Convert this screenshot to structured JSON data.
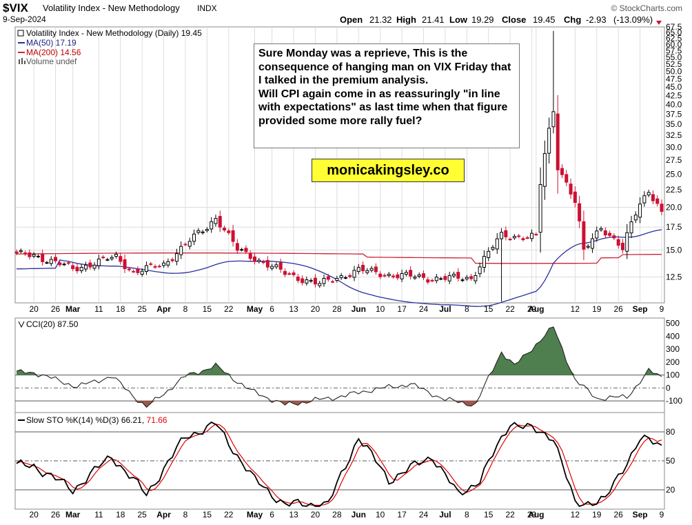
{
  "chart_data": [
    {
      "type": "candlestick",
      "symbol": "$VIX",
      "title": "Volatility Index - New Methodology",
      "exchange": "INDX",
      "date": "9-Sep-2024",
      "ohlc": {
        "open_label": "Open",
        "open": "21.32",
        "high_label": "High",
        "high": "21.41",
        "low_label": "Low",
        "low": "19.29",
        "close_label": "Close",
        "close": "19.45",
        "chg_label": "Chg",
        "chg": "-2.93",
        "chg_pct": "(-13.09%)"
      },
      "source": "© StockCharts.com",
      "legend": [
        {
          "name": "Volatility Index - New Methodology (Daily) 19.45",
          "color": "#000000"
        },
        {
          "name": "MA(50) 17.19",
          "color": "#1a237e"
        },
        {
          "name": "MA(200) 14.56",
          "color": "#c00000"
        },
        {
          "name": "Volume undef",
          "color": "#555555"
        }
      ],
      "yscale": "log",
      "ylim": [
        10.5,
        67.5
      ],
      "yticks": [
        "12.5",
        "15.0",
        "17.5",
        "20.0",
        "22.5",
        "25.0",
        "27.5",
        "30.0",
        "32.5",
        "35.0",
        "37.5",
        "40.0",
        "42.5",
        "45.0",
        "47.5",
        "50.0",
        "52.5",
        "55.0",
        "57.5",
        "60.0",
        "62.5",
        "65.0",
        "67.5"
      ],
      "xticks": [
        "20",
        "26",
        "Mar",
        "11",
        "18",
        "25",
        "Apr",
        "8",
        "15",
        "22",
        "May",
        "6",
        "13",
        "20",
        "28",
        "Jun",
        "10",
        "17",
        "24",
        "Jul",
        "8",
        "15",
        "22",
        "29",
        "Aug",
        "12",
        "19",
        "26",
        "Sep",
        "9"
      ],
      "ma50_last": 17.19,
      "ma200_last": 14.56,
      "last_close": 19.45,
      "anchors": [
        {
          "date": "Feb 20",
          "value": 14.5
        },
        {
          "date": "Mar 1",
          "value": 13.2
        },
        {
          "date": "Mar 15",
          "value": 14.3
        },
        {
          "date": "Mar 21",
          "value": 12.9
        },
        {
          "date": "Apr 1",
          "value": 13.6
        },
        {
          "date": "Apr 15",
          "value": 17.5
        },
        {
          "date": "Apr 19",
          "value": 18.7
        },
        {
          "date": "Apr 26",
          "value": 15.0
        },
        {
          "date": "May 10",
          "value": 12.8
        },
        {
          "date": "May 22",
          "value": 11.9
        },
        {
          "date": "Jun 3",
          "value": 13.1
        },
        {
          "date": "Jun 14",
          "value": 12.7
        },
        {
          "date": "Jun 28",
          "value": 12.4
        },
        {
          "date": "Jul 10",
          "value": 12.4
        },
        {
          "date": "Jul 19",
          "value": 16.5
        },
        {
          "date": "Jul 31",
          "value": 16.4
        },
        {
          "date": "Aug 2",
          "value": 23.4
        },
        {
          "date": "Aug 5",
          "value": 38.6
        },
        {
          "date": "Aug 7",
          "value": 27.9
        },
        {
          "date": "Aug 12",
          "value": 20.7
        },
        {
          "date": "Aug 16",
          "value": 14.8
        },
        {
          "date": "Aug 22",
          "value": 17.6
        },
        {
          "date": "Aug 29",
          "value": 15.0
        },
        {
          "date": "Sep 3",
          "value": 20.7
        },
        {
          "date": "Sep 6",
          "value": 22.4
        },
        {
          "date": "Sep 9",
          "value": 19.45
        }
      ]
    },
    {
      "type": "line",
      "title": "CCI(20) 87.50",
      "yticks": [
        "-100",
        "0",
        "100",
        "200",
        "300",
        "400",
        "500"
      ],
      "ylim": [
        -190,
        540
      ],
      "last": 87.5,
      "anchors": [
        {
          "date": "Feb 20",
          "value": 120
        },
        {
          "date": "Mar 4",
          "value": 10
        },
        {
          "date": "Mar 14",
          "value": 90
        },
        {
          "date": "Mar 26",
          "value": -150
        },
        {
          "date": "Apr 8",
          "value": 90
        },
        {
          "date": "Apr 19",
          "value": 170
        },
        {
          "date": "Apr 30",
          "value": -20
        },
        {
          "date": "May 10",
          "value": -130
        },
        {
          "date": "May 30",
          "value": -60
        },
        {
          "date": "Jun 7",
          "value": -20
        },
        {
          "date": "Jun 21",
          "value": 30
        },
        {
          "date": "Jul 1",
          "value": -90
        },
        {
          "date": "Jul 11",
          "value": -130
        },
        {
          "date": "Jul 19",
          "value": 280
        },
        {
          "date": "Jul 24",
          "value": 170
        },
        {
          "date": "Aug 5",
          "value": 470
        },
        {
          "date": "Aug 12",
          "value": 60
        },
        {
          "date": "Aug 20",
          "value": -80
        },
        {
          "date": "Aug 30",
          "value": -70
        },
        {
          "date": "Sep 6",
          "value": 130
        },
        {
          "date": "Sep 9",
          "value": 87.5
        }
      ]
    },
    {
      "type": "line",
      "title": "Slow STO %K(14) %D(3) 66.21, 71.66",
      "series": [
        {
          "name": "%K(14)",
          "color": "#000000",
          "last": 66.21
        },
        {
          "name": "%D(3)",
          "color": "#e00000",
          "last": 71.66
        }
      ],
      "yticks": [
        "20",
        "50",
        "80"
      ],
      "ylim": [
        0,
        100
      ],
      "anchors": [
        {
          "date": "Feb 20",
          "value": 45
        },
        {
          "date": "Mar 1",
          "value": 20
        },
        {
          "date": "Mar 14",
          "value": 55
        },
        {
          "date": "Mar 26",
          "value": 15
        },
        {
          "date": "Apr 10",
          "value": 75
        },
        {
          "date": "Apr 19",
          "value": 88
        },
        {
          "date": "May 1",
          "value": 30
        },
        {
          "date": "May 10",
          "value": 5
        },
        {
          "date": "May 24",
          "value": 5
        },
        {
          "date": "Jun 5",
          "value": 75
        },
        {
          "date": "Jun 14",
          "value": 30
        },
        {
          "date": "Jun 28",
          "value": 55
        },
        {
          "date": "Jul 5",
          "value": 15
        },
        {
          "date": "Jul 12",
          "value": 30
        },
        {
          "date": "Jul 23",
          "value": 90
        },
        {
          "date": "Aug 5",
          "value": 75
        },
        {
          "date": "Aug 14",
          "value": 5
        },
        {
          "date": "Aug 23",
          "value": 10
        },
        {
          "date": "Sep 3",
          "value": 73
        },
        {
          "date": "Sep 9",
          "value": 66
        }
      ]
    }
  ],
  "annotation": {
    "text": "Sure Monday was a reprieve, This is the consequence of hanging man on VIX Friday that I talked in the premium analysis.\nWill CPI again come in as reassuringly \"in line with expectations\" as last time when that figure provided some more rally fuel?"
  },
  "brand_label": "monicakingsley.co",
  "colors": {
    "up": "#000000",
    "down": "#cc1133",
    "ma50": "#2a2d9c",
    "ma200": "#cc2233",
    "cci_fill_pos": "#4f7f4f",
    "cci_fill_neg": "#a0574a",
    "sto_d": "#e00000",
    "grid": "#dddddd"
  }
}
